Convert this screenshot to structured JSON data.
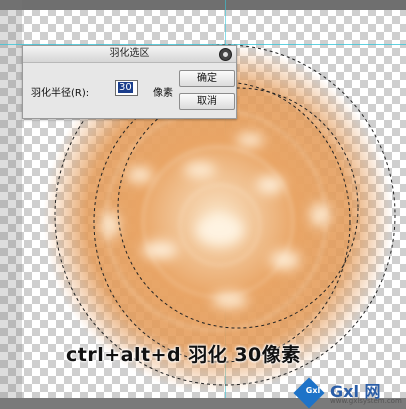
{
  "dialog": {
    "title": "羽化选区",
    "radius_label": "羽化半径(R):",
    "radius_value": "30",
    "unit": "像素",
    "ok_label": "确定",
    "cancel_label": "取消"
  },
  "caption": "ctrl+alt+d  羽化 30像素",
  "watermark": {
    "logo_text": "Gxl",
    "name": "Gxl 网",
    "url": "www.gxlsystem.com"
  },
  "colors": {
    "glow": "#e8a060",
    "glow_light": "#f6d6ae",
    "accent_guide": "#39c6d8"
  }
}
